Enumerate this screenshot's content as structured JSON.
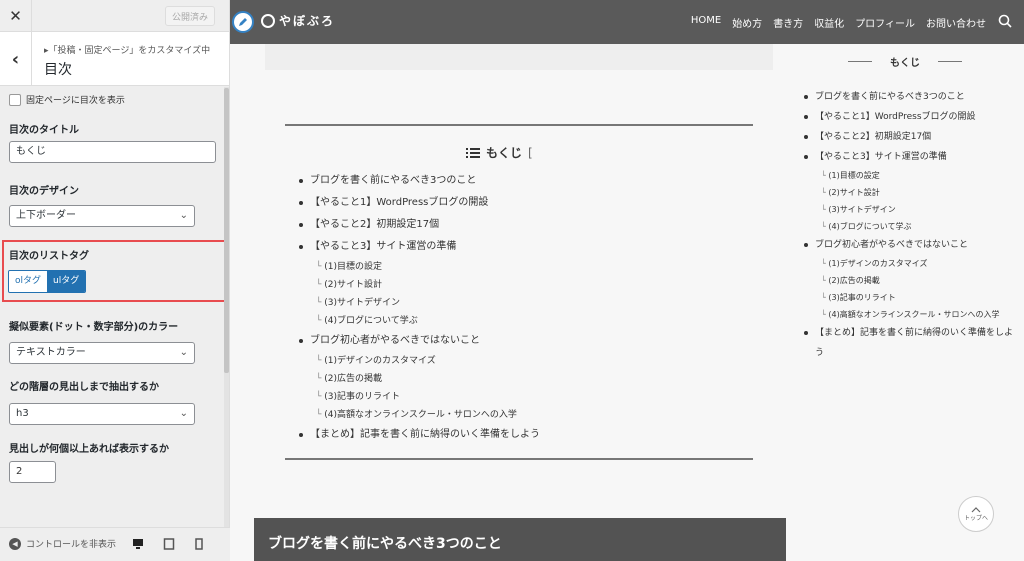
{
  "panel": {
    "close_icon": "close-icon",
    "publish_label": "公開済み",
    "breadcrumb": "「投稿・固定ページ」をカスタマイズ中",
    "title": "目次",
    "checkbox_label": "固定ページに目次を表示",
    "toc_title_label": "目次のタイトル",
    "toc_title_value": "もくじ",
    "design_label": "目次のデザイン",
    "design_value": "上下ボーダー",
    "list_tag_label": "目次のリストタグ",
    "list_tag_options": [
      "olタグ",
      "ulタグ"
    ],
    "list_tag_selected": "ulタグ",
    "pseudo_color_label": "擬似要素(ドット・数字部分)のカラー",
    "pseudo_color_value": "テキストカラー",
    "depth_label": "どの階層の見出しまで抽出するか",
    "depth_value": "h3",
    "min_count_label": "見出しが何個以上あれば表示するか",
    "min_count_value": "2",
    "hide_controls": "コントロールを非表示"
  },
  "site": {
    "logo_text": "やぼぶろ",
    "nav": [
      "HOME",
      "始め方",
      "書き方",
      "収益化",
      "プロフィール",
      "お問い合わせ"
    ],
    "toc_title": "もくじ",
    "toc": [
      {
        "label": "ブログを書く前にやるべき3つのこと",
        "children": []
      },
      {
        "label": "【やること1】WordPressブログの開設",
        "children": []
      },
      {
        "label": "【やること2】初期設定17個",
        "children": []
      },
      {
        "label": "【やること3】サイト運営の準備",
        "children": [
          "(1)目標の設定",
          "(2)サイト設計",
          "(3)サイトデザイン",
          "(4)ブログについて学ぶ"
        ]
      },
      {
        "label": "ブログ初心者がやるべきではないこと",
        "children": [
          "(1)デザインのカスタマイズ",
          "(2)広告の掲載",
          "(3)記事のリライト",
          "(4)高額なオンラインスクール・サロンへの入学"
        ]
      },
      {
        "label": "【まとめ】記事を書く前に納得のいく準備をしよう",
        "children": []
      }
    ],
    "h2": "ブログを書く前にやるべき3つのこと",
    "sidebar_title": "もくじ",
    "to_top": "トップへ"
  },
  "colors": {
    "accent": "#2271b1",
    "highlight": "#e84c4f",
    "header": "#5a5a5a"
  }
}
